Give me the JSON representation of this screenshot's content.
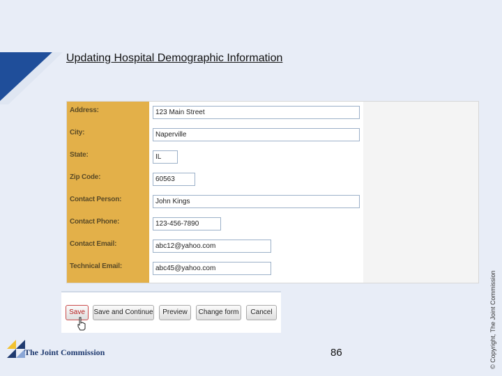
{
  "slide": {
    "title": "Updating Hospital Demographic Information",
    "copyright": "© Copyright, The Joint Commission",
    "page_number": "86"
  },
  "form": {
    "fields": [
      {
        "label": "Address:",
        "value": "123 Main Street"
      },
      {
        "label": "City:",
        "value": "Naperville"
      },
      {
        "label": "State:",
        "value": "IL"
      },
      {
        "label": "Zip Code:",
        "value": "60563"
      },
      {
        "label": "Contact Person:",
        "value": "John Kings"
      },
      {
        "label": "Contact Phone:",
        "value": "123-456-7890"
      },
      {
        "label": "Contact Email:",
        "value": "abc12@yahoo.com"
      },
      {
        "label": "Technical Email:",
        "value": "abc45@yahoo.com"
      }
    ]
  },
  "buttons": {
    "save": "Save",
    "save_continue": "Save and Continue",
    "preview": "Preview",
    "change_form": "Change form",
    "cancel": "Cancel"
  },
  "footer": {
    "logo_text": "The Joint Commission"
  },
  "colors": {
    "background": "#e8edf7",
    "label_column": "#e3b049",
    "brand_blue": "#1f3a6f",
    "brand_yellow": "#f2c230"
  },
  "icons": {
    "cursor": "hand-pointer-icon"
  }
}
